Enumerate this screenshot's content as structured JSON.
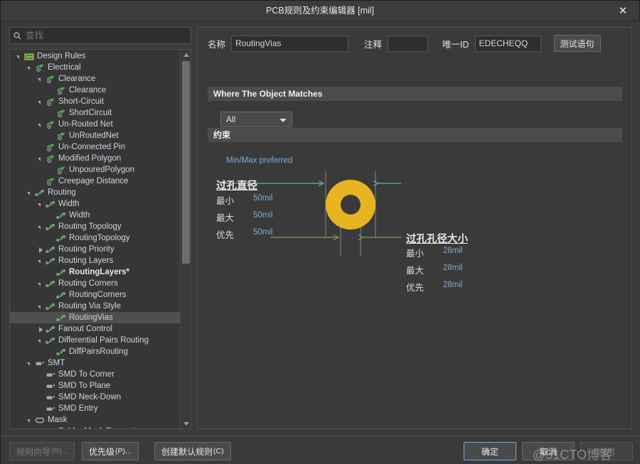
{
  "window": {
    "title": "PCB规则及约束编辑器 [mil]",
    "close_label": "✕"
  },
  "search": {
    "placeholder": "查找",
    "value": "",
    "icon": "search-icon"
  },
  "tree": {
    "items": [
      {
        "label": "Design Rules",
        "depth": 0,
        "icon": "design-rules-icon",
        "expander": "open",
        "selected": false,
        "bold": false
      },
      {
        "label": "Electrical",
        "depth": 1,
        "icon": "electrical-icon",
        "expander": "open",
        "selected": false,
        "bold": false
      },
      {
        "label": "Clearance",
        "depth": 2,
        "icon": "electrical-icon",
        "expander": "open",
        "selected": false,
        "bold": false
      },
      {
        "label": "Clearance",
        "depth": 3,
        "icon": "electrical-icon",
        "expander": "none",
        "selected": false,
        "bold": false
      },
      {
        "label": "Short-Circuit",
        "depth": 2,
        "icon": "electrical-icon",
        "expander": "open",
        "selected": false,
        "bold": false
      },
      {
        "label": "ShortCircuit",
        "depth": 3,
        "icon": "electrical-icon",
        "expander": "none",
        "selected": false,
        "bold": false
      },
      {
        "label": "Un-Routed Net",
        "depth": 2,
        "icon": "electrical-icon",
        "expander": "open",
        "selected": false,
        "bold": false
      },
      {
        "label": "UnRoutedNet",
        "depth": 3,
        "icon": "electrical-icon",
        "expander": "none",
        "selected": false,
        "bold": false
      },
      {
        "label": "Un-Connected Pin",
        "depth": 2,
        "icon": "electrical-icon",
        "expander": "none",
        "selected": false,
        "bold": false
      },
      {
        "label": "Modified Polygon",
        "depth": 2,
        "icon": "electrical-icon",
        "expander": "open",
        "selected": false,
        "bold": false
      },
      {
        "label": "UnpouredPolygon",
        "depth": 3,
        "icon": "electrical-icon",
        "expander": "none",
        "selected": false,
        "bold": false
      },
      {
        "label": "Creepage Distance",
        "depth": 2,
        "icon": "electrical-icon",
        "expander": "none",
        "selected": false,
        "bold": false
      },
      {
        "label": "Routing",
        "depth": 1,
        "icon": "routing-icon",
        "expander": "open",
        "selected": false,
        "bold": false
      },
      {
        "label": "Width",
        "depth": 2,
        "icon": "routing-icon",
        "expander": "open",
        "selected": false,
        "bold": false
      },
      {
        "label": "Width",
        "depth": 3,
        "icon": "routing-icon",
        "expander": "none",
        "selected": false,
        "bold": false
      },
      {
        "label": "Routing Topology",
        "depth": 2,
        "icon": "routing-icon",
        "expander": "open",
        "selected": false,
        "bold": false
      },
      {
        "label": "RoutingTopology",
        "depth": 3,
        "icon": "routing-icon",
        "expander": "none",
        "selected": false,
        "bold": false
      },
      {
        "label": "Routing Priority",
        "depth": 2,
        "icon": "routing-icon",
        "expander": "closed",
        "selected": false,
        "bold": false
      },
      {
        "label": "Routing Layers",
        "depth": 2,
        "icon": "routing-icon",
        "expander": "open",
        "selected": false,
        "bold": false
      },
      {
        "label": "RoutingLayers*",
        "depth": 3,
        "icon": "routing-icon",
        "expander": "none",
        "selected": false,
        "bold": true
      },
      {
        "label": "Routing Corners",
        "depth": 2,
        "icon": "routing-icon",
        "expander": "open",
        "selected": false,
        "bold": false
      },
      {
        "label": "RoutingCorners",
        "depth": 3,
        "icon": "routing-icon",
        "expander": "none",
        "selected": false,
        "bold": false
      },
      {
        "label": "Routing Via Style",
        "depth": 2,
        "icon": "routing-icon",
        "expander": "open",
        "selected": false,
        "bold": false
      },
      {
        "label": "RoutingVias",
        "depth": 3,
        "icon": "routing-icon",
        "expander": "none",
        "selected": true,
        "bold": false
      },
      {
        "label": "Fanout Control",
        "depth": 2,
        "icon": "routing-icon",
        "expander": "closed",
        "selected": false,
        "bold": false
      },
      {
        "label": "Differential Pairs Routing",
        "depth": 2,
        "icon": "routing-icon",
        "expander": "open",
        "selected": false,
        "bold": false
      },
      {
        "label": "DiffPairsRouting",
        "depth": 3,
        "icon": "routing-icon",
        "expander": "none",
        "selected": false,
        "bold": false
      },
      {
        "label": "SMT",
        "depth": 1,
        "icon": "smt-icon",
        "expander": "open",
        "selected": false,
        "bold": false
      },
      {
        "label": "SMD To Corner",
        "depth": 2,
        "icon": "smt-icon",
        "expander": "none",
        "selected": false,
        "bold": false
      },
      {
        "label": "SMD To Plane",
        "depth": 2,
        "icon": "smt-icon",
        "expander": "none",
        "selected": false,
        "bold": false
      },
      {
        "label": "SMD Neck-Down",
        "depth": 2,
        "icon": "smt-icon",
        "expander": "none",
        "selected": false,
        "bold": false
      },
      {
        "label": "SMD Entry",
        "depth": 2,
        "icon": "smt-icon",
        "expander": "none",
        "selected": false,
        "bold": false
      },
      {
        "label": "Mask",
        "depth": 1,
        "icon": "mask-icon",
        "expander": "open",
        "selected": false,
        "bold": false
      },
      {
        "label": "Solder Mask Expansion",
        "depth": 2,
        "icon": "mask-icon",
        "expander": "none",
        "selected": false,
        "bold": false
      }
    ]
  },
  "form": {
    "name_label": "名称",
    "name_value": "RoutingVias",
    "comment_label": "注释",
    "comment_value": "",
    "uid_label": "唯一ID",
    "uid_value": "EDECHEQQ",
    "test_query_label": "测试语句"
  },
  "sections": {
    "where_label": "Where The Object Matches",
    "scope_value": "All",
    "constraints_label": "约束"
  },
  "constraint": {
    "note": "Min/Max preferred",
    "via_diameter": {
      "title": "过孔直径",
      "min_label": "最小",
      "min_value": "50mil",
      "max_label": "最大",
      "max_value": "50mil",
      "pref_label": "优先",
      "pref_value": "50mil"
    },
    "via_hole": {
      "title": "过孔孔径大小",
      "min_label": "最小",
      "min_value": "28mil",
      "max_label": "最大",
      "max_value": "28mil",
      "pref_label": "优先",
      "pref_value": "28mil"
    }
  },
  "colors": {
    "via_ring": "#e8b41f",
    "diameter_arrow": "#62b5b0",
    "hole_arrow": "#8a9a4a",
    "value_text": "#7fa9d8",
    "panel_bg": "#3a3a3a"
  },
  "footer": {
    "rule_wizard": "规则向导",
    "rule_wizard_hk": "(R)...",
    "priority": "优先级",
    "priority_hk": "(P)...",
    "create_default": "创建默认规则",
    "create_default_hk": "(C)",
    "ok": "确定",
    "cancel": "取消",
    "apply": "应用"
  },
  "watermark": {
    "text": "@51CTO博客"
  }
}
